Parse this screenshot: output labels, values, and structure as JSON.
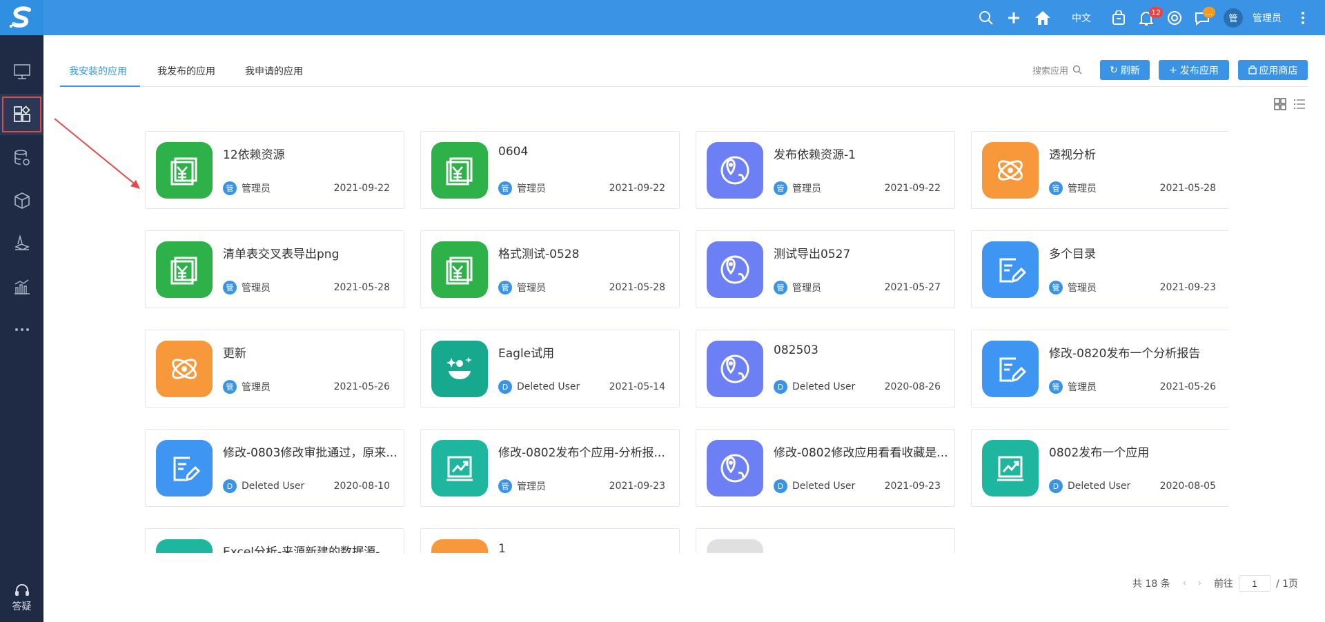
{
  "sidebar": {
    "items": [
      {
        "icon": "monitor-icon"
      },
      {
        "icon": "apps-grid-icon",
        "active": true
      },
      {
        "icon": "database-settings-icon"
      },
      {
        "icon": "cube-icon"
      },
      {
        "icon": "layers-icon"
      },
      {
        "icon": "bar-chart-icon"
      },
      {
        "icon": "more-dots-icon"
      }
    ],
    "help_label": "答疑"
  },
  "topbar": {
    "language": "中文",
    "notification_count": "12",
    "message_badge": "...",
    "avatar_text": "管",
    "username": "管理员"
  },
  "tabs": [
    {
      "label": "我安装的应用",
      "active": true
    },
    {
      "label": "我发布的应用",
      "active": false
    },
    {
      "label": "我申请的应用",
      "active": false
    }
  ],
  "toolbar": {
    "search_label": "搜索应用",
    "refresh_label": "刷新",
    "publish_label": "发布应用",
    "store_label": "应用商店"
  },
  "cards": [
    {
      "title": "12依赖资源",
      "owner_badge": "管",
      "owner": "管理员",
      "date": "2021-09-22",
      "icon": "yuan-report-icon",
      "color": "#2fb14a"
    },
    {
      "title": "0604",
      "owner_badge": "管",
      "owner": "管理员",
      "date": "2021-09-22",
      "icon": "yuan-report-icon",
      "color": "#2fb14a"
    },
    {
      "title": "发布依赖资源-1",
      "owner_badge": "管",
      "owner": "管理员",
      "date": "2021-09-22",
      "icon": "map-pin-icon",
      "color": "#6d7ff4"
    },
    {
      "title": "透视分析",
      "owner_badge": "管",
      "owner": "管理员",
      "date": "2021-05-28",
      "icon": "atom-icon",
      "color": "#f7993a"
    },
    {
      "title": "清单表交叉表导出png",
      "owner_badge": "管",
      "owner": "管理员",
      "date": "2021-05-28",
      "icon": "yuan-report-icon",
      "color": "#2fb14a"
    },
    {
      "title": "格式测试-0528",
      "owner_badge": "管",
      "owner": "管理员",
      "date": "2021-05-28",
      "icon": "yuan-report-icon",
      "color": "#2fb14a"
    },
    {
      "title": "测试导出0527",
      "owner_badge": "管",
      "owner": "管理员",
      "date": "2021-05-27",
      "icon": "map-pin-icon",
      "color": "#6d7ff4"
    },
    {
      "title": "多个目录",
      "owner_badge": "管",
      "owner": "管理员",
      "date": "2021-09-23",
      "icon": "edit-doc-icon",
      "color": "#3e95f2"
    },
    {
      "title": "更新",
      "owner_badge": "管",
      "owner": "管理员",
      "date": "2021-05-26",
      "icon": "atom-icon",
      "color": "#f7993a"
    },
    {
      "title": "Eagle试用",
      "owner_badge": "D",
      "owner": "Deleted User",
      "date": "2021-05-14",
      "icon": "smile-sparkle-icon",
      "color": "#17a98e"
    },
    {
      "title": "082503",
      "owner_badge": "D",
      "owner": "Deleted User",
      "date": "2020-08-26",
      "icon": "map-pin-icon",
      "color": "#6d7ff4"
    },
    {
      "title": "修改-0820发布一个分析报告",
      "owner_badge": "管",
      "owner": "管理员",
      "date": "2021-05-26",
      "icon": "edit-doc-icon",
      "color": "#3e95f2"
    },
    {
      "title": "修改-0803修改审批通过，原来...",
      "owner_badge": "D",
      "owner": "Deleted User",
      "date": "2020-08-10",
      "icon": "edit-doc-icon",
      "color": "#3e95f2"
    },
    {
      "title": "修改-0802发布个应用-分析报...",
      "owner_badge": "管",
      "owner": "管理员",
      "date": "2021-09-23",
      "icon": "trend-chart-icon",
      "color": "#1fb6a0"
    },
    {
      "title": "修改-0802修改应用看看收藏是...",
      "owner_badge": "D",
      "owner": "Deleted User",
      "date": "2021-09-23",
      "icon": "map-pin-icon",
      "color": "#6d7ff4"
    },
    {
      "title": "0802发布一个应用",
      "owner_badge": "D",
      "owner": "Deleted User",
      "date": "2020-08-05",
      "icon": "trend-chart-icon",
      "color": "#1fb6a0"
    },
    {
      "title": "Excel分析-来源新建的数据源-...",
      "owner_badge": "",
      "owner": "",
      "date": "",
      "icon": "trend-chart-icon",
      "color": "#1fb6a0"
    },
    {
      "title": "1",
      "owner_badge": "",
      "owner": "",
      "date": "",
      "icon": "atom-icon",
      "color": "#f7993a"
    },
    {
      "title": "",
      "owner_badge": "",
      "owner": "",
      "date": "",
      "icon": "placeholder-icon",
      "color": "#e0e0e0"
    }
  ],
  "pagination": {
    "total_label": "共 18 条",
    "goto_label": "前往",
    "page_value": "1",
    "pages_label": "/ 1页"
  },
  "colors": {
    "sidebar_bg": "#1f2b44",
    "topbar_bg": "#3b93e6",
    "accent": "#3b93e6",
    "highlight_box": "#e24a4a"
  }
}
